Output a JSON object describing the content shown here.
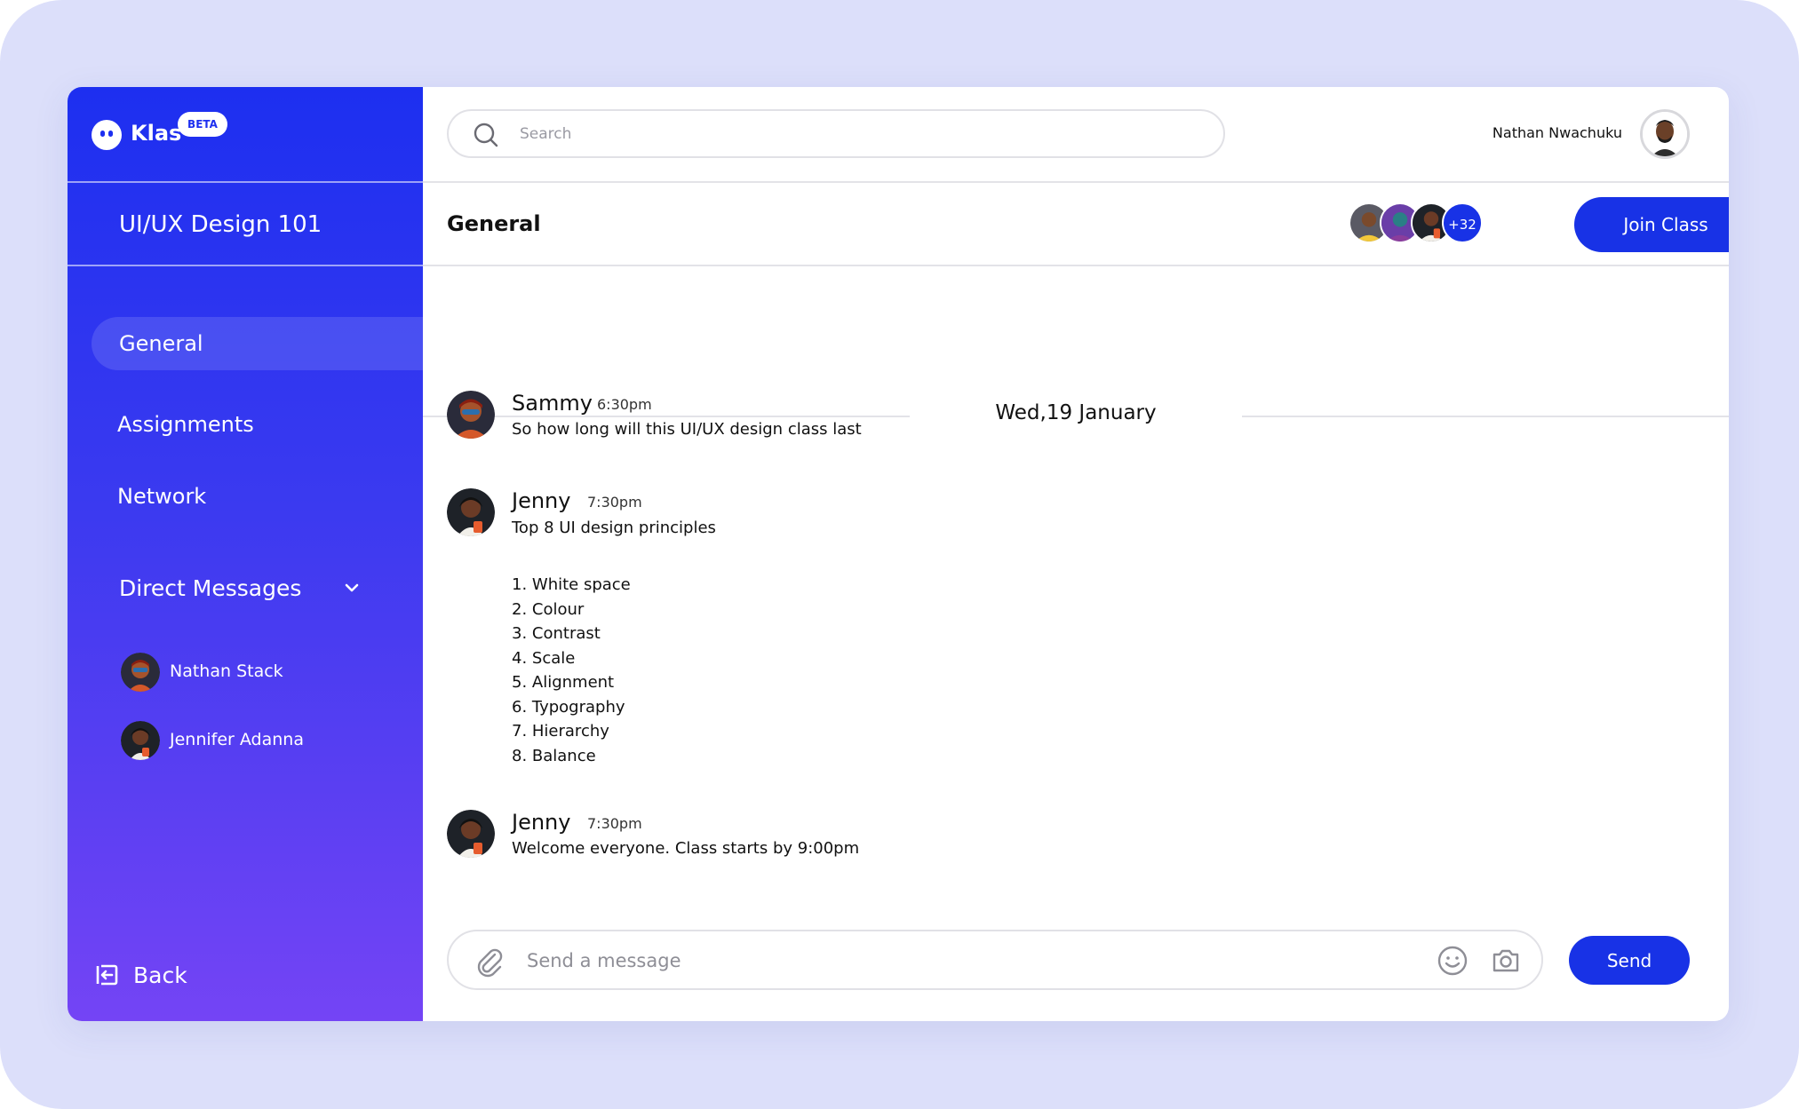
{
  "app": {
    "name": "Klas",
    "badge": "BETA"
  },
  "sidebar": {
    "course_title": "UI/UX Design 101",
    "nav": [
      {
        "label": "General",
        "active": true
      },
      {
        "label": "Assignments",
        "active": false
      },
      {
        "label": "Network",
        "active": false
      }
    ],
    "direct_messages": {
      "label": "Direct Messages",
      "items": [
        {
          "name": "Nathan Stack"
        },
        {
          "name": "Jennifer Adanna"
        }
      ]
    },
    "back_label": "Back"
  },
  "header": {
    "search_placeholder": "Search",
    "user_name": "Nathan Nwachuku"
  },
  "channel": {
    "title": "General",
    "member_extra_count": "+32",
    "join_label": "Join Class"
  },
  "chat": {
    "date": "Wed,19 January",
    "messages": [
      {
        "author": "Sammy",
        "time": "6:30pm",
        "text": "So how long will this UI/UX design class last"
      },
      {
        "author": "Jenny",
        "time": "7:30pm",
        "text": "Top 8 UI design principles",
        "list": [
          "1. White space",
          "2. Colour",
          "3. Contrast",
          "4. Scale",
          "5. Alignment",
          "6. Typography",
          "7. Hierarchy",
          "8. Balance"
        ]
      },
      {
        "author": "Jenny",
        "time": "7:30pm",
        "text": "Welcome everyone. Class starts by 9:00pm"
      }
    ]
  },
  "composer": {
    "placeholder": "Send a message",
    "send_label": "Send"
  },
  "colors": {
    "accent": "#1832e6",
    "sidebar_top": "#1d2ff0",
    "sidebar_bottom": "#7444f5",
    "frame_bg": "#dcdffa"
  }
}
